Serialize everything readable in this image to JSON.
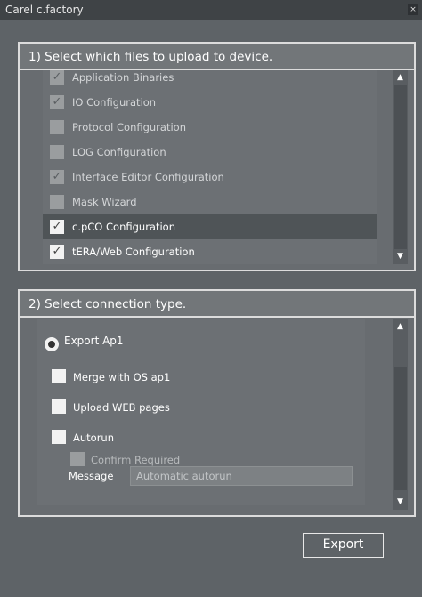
{
  "window": {
    "title": "Carel c.factory",
    "close_glyph": "×"
  },
  "files_group": {
    "header": "1) Select which files to upload to device.",
    "items": [
      {
        "label": "Application Binaries",
        "checked": true,
        "enabled": false,
        "selected": false
      },
      {
        "label": "IO Configuration",
        "checked": true,
        "enabled": false,
        "selected": false
      },
      {
        "label": "Protocol Configuration",
        "checked": false,
        "enabled": false,
        "selected": false
      },
      {
        "label": "LOG Configuration",
        "checked": false,
        "enabled": false,
        "selected": false
      },
      {
        "label": "Interface Editor Configuration",
        "checked": true,
        "enabled": false,
        "selected": false
      },
      {
        "label": "Mask Wizard",
        "checked": false,
        "enabled": false,
        "selected": false
      },
      {
        "label": "c.pCO Configuration",
        "checked": true,
        "enabled": true,
        "selected": true
      },
      {
        "label": "tERA/Web Configuration",
        "checked": true,
        "enabled": true,
        "selected": false
      }
    ],
    "scroll_up_glyph": "▲",
    "scroll_down_glyph": "▼"
  },
  "connection_group": {
    "header": "2) Select connection type.",
    "export_option": {
      "label": "Export Ap1",
      "selected": true
    },
    "merge_os": {
      "label": "Merge with OS ap1",
      "checked": false
    },
    "upload_web": {
      "label": "Upload WEB pages",
      "checked": false
    },
    "autorun": {
      "label": "Autorun",
      "checked": false
    },
    "confirm_required": {
      "label": "Confirm Required",
      "checked": false,
      "enabled": false
    },
    "message": {
      "label": "Message",
      "placeholder": "Automatic autorun"
    },
    "scroll_up_glyph": "▲",
    "scroll_down_glyph": "▼"
  },
  "actions": {
    "export_label": "Export"
  },
  "icons": {
    "check": "✓"
  }
}
